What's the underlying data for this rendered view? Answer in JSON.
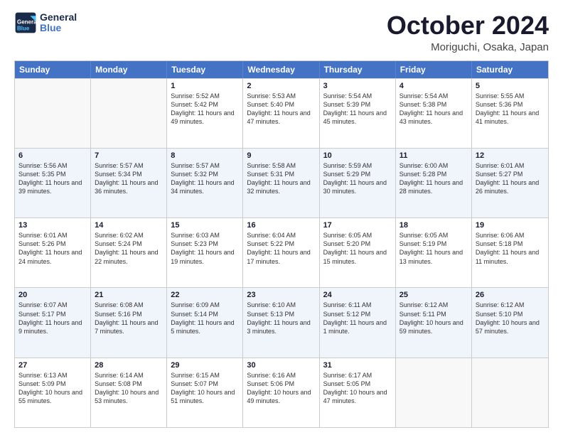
{
  "header": {
    "logo_line1": "General",
    "logo_line2": "Blue",
    "month_title": "October 2024",
    "location": "Moriguchi, Osaka, Japan"
  },
  "days_of_week": [
    "Sunday",
    "Monday",
    "Tuesday",
    "Wednesday",
    "Thursday",
    "Friday",
    "Saturday"
  ],
  "weeks": [
    [
      {
        "day": "",
        "empty": true,
        "text": ""
      },
      {
        "day": "",
        "empty": true,
        "text": ""
      },
      {
        "day": "1",
        "text": "Sunrise: 5:52 AM\nSunset: 5:42 PM\nDaylight: 11 hours and 49 minutes."
      },
      {
        "day": "2",
        "text": "Sunrise: 5:53 AM\nSunset: 5:40 PM\nDaylight: 11 hours and 47 minutes."
      },
      {
        "day": "3",
        "text": "Sunrise: 5:54 AM\nSunset: 5:39 PM\nDaylight: 11 hours and 45 minutes."
      },
      {
        "day": "4",
        "text": "Sunrise: 5:54 AM\nSunset: 5:38 PM\nDaylight: 11 hours and 43 minutes."
      },
      {
        "day": "5",
        "text": "Sunrise: 5:55 AM\nSunset: 5:36 PM\nDaylight: 11 hours and 41 minutes."
      }
    ],
    [
      {
        "day": "6",
        "text": "Sunrise: 5:56 AM\nSunset: 5:35 PM\nDaylight: 11 hours and 39 minutes."
      },
      {
        "day": "7",
        "text": "Sunrise: 5:57 AM\nSunset: 5:34 PM\nDaylight: 11 hours and 36 minutes."
      },
      {
        "day": "8",
        "text": "Sunrise: 5:57 AM\nSunset: 5:32 PM\nDaylight: 11 hours and 34 minutes."
      },
      {
        "day": "9",
        "text": "Sunrise: 5:58 AM\nSunset: 5:31 PM\nDaylight: 11 hours and 32 minutes."
      },
      {
        "day": "10",
        "text": "Sunrise: 5:59 AM\nSunset: 5:29 PM\nDaylight: 11 hours and 30 minutes."
      },
      {
        "day": "11",
        "text": "Sunrise: 6:00 AM\nSunset: 5:28 PM\nDaylight: 11 hours and 28 minutes."
      },
      {
        "day": "12",
        "text": "Sunrise: 6:01 AM\nSunset: 5:27 PM\nDaylight: 11 hours and 26 minutes."
      }
    ],
    [
      {
        "day": "13",
        "text": "Sunrise: 6:01 AM\nSunset: 5:26 PM\nDaylight: 11 hours and 24 minutes."
      },
      {
        "day": "14",
        "text": "Sunrise: 6:02 AM\nSunset: 5:24 PM\nDaylight: 11 hours and 22 minutes."
      },
      {
        "day": "15",
        "text": "Sunrise: 6:03 AM\nSunset: 5:23 PM\nDaylight: 11 hours and 19 minutes."
      },
      {
        "day": "16",
        "text": "Sunrise: 6:04 AM\nSunset: 5:22 PM\nDaylight: 11 hours and 17 minutes."
      },
      {
        "day": "17",
        "text": "Sunrise: 6:05 AM\nSunset: 5:20 PM\nDaylight: 11 hours and 15 minutes."
      },
      {
        "day": "18",
        "text": "Sunrise: 6:05 AM\nSunset: 5:19 PM\nDaylight: 11 hours and 13 minutes."
      },
      {
        "day": "19",
        "text": "Sunrise: 6:06 AM\nSunset: 5:18 PM\nDaylight: 11 hours and 11 minutes."
      }
    ],
    [
      {
        "day": "20",
        "text": "Sunrise: 6:07 AM\nSunset: 5:17 PM\nDaylight: 11 hours and 9 minutes."
      },
      {
        "day": "21",
        "text": "Sunrise: 6:08 AM\nSunset: 5:16 PM\nDaylight: 11 hours and 7 minutes."
      },
      {
        "day": "22",
        "text": "Sunrise: 6:09 AM\nSunset: 5:14 PM\nDaylight: 11 hours and 5 minutes."
      },
      {
        "day": "23",
        "text": "Sunrise: 6:10 AM\nSunset: 5:13 PM\nDaylight: 11 hours and 3 minutes."
      },
      {
        "day": "24",
        "text": "Sunrise: 6:11 AM\nSunset: 5:12 PM\nDaylight: 11 hours and 1 minute."
      },
      {
        "day": "25",
        "text": "Sunrise: 6:12 AM\nSunset: 5:11 PM\nDaylight: 10 hours and 59 minutes."
      },
      {
        "day": "26",
        "text": "Sunrise: 6:12 AM\nSunset: 5:10 PM\nDaylight: 10 hours and 57 minutes."
      }
    ],
    [
      {
        "day": "27",
        "text": "Sunrise: 6:13 AM\nSunset: 5:09 PM\nDaylight: 10 hours and 55 minutes."
      },
      {
        "day": "28",
        "text": "Sunrise: 6:14 AM\nSunset: 5:08 PM\nDaylight: 10 hours and 53 minutes."
      },
      {
        "day": "29",
        "text": "Sunrise: 6:15 AM\nSunset: 5:07 PM\nDaylight: 10 hours and 51 minutes."
      },
      {
        "day": "30",
        "text": "Sunrise: 6:16 AM\nSunset: 5:06 PM\nDaylight: 10 hours and 49 minutes."
      },
      {
        "day": "31",
        "text": "Sunrise: 6:17 AM\nSunset: 5:05 PM\nDaylight: 10 hours and 47 minutes."
      },
      {
        "day": "",
        "empty": true,
        "text": ""
      },
      {
        "day": "",
        "empty": true,
        "text": ""
      }
    ]
  ]
}
